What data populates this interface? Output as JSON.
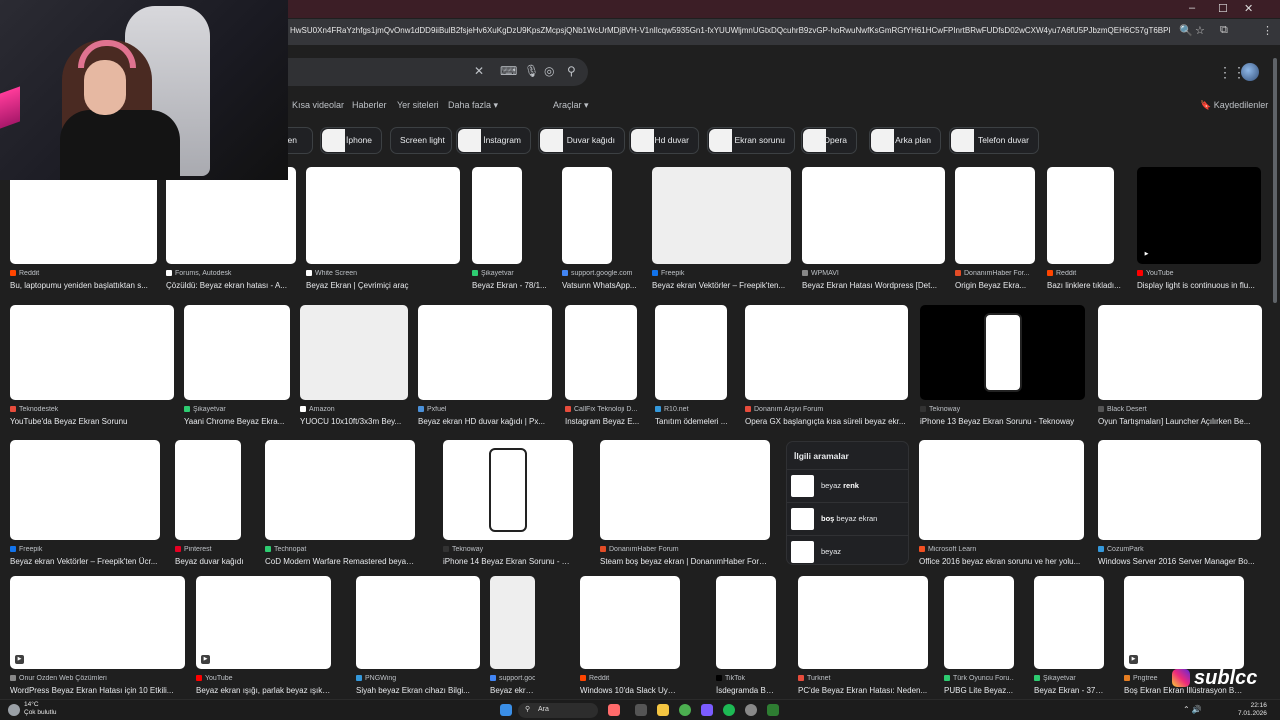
{
  "browser": {
    "url": "HwSU0Xn4FRaYzhfgs1jmQvOnw1dDD9iiBulB2fsjeHv6XuKgDzU9KpsZMcpsjQNb1WcUrMDj8VH-V1nIlcqw5935Gn1-fxYUUWljmnUGtxDQcuhrB9zvGP-hoRwuNwfKsGmRGfYH61HCwFPInrtBRwFUDfsD02wCXW4yu7A6fU5PJbzmQEH6C57gT6BPkdyn-GMIWObrYH0d93TWbG3mRemJys13yP...",
    "window_controls": [
      "–",
      "☐",
      "✕"
    ]
  },
  "search": {
    "query": "",
    "clear_icon": "close-icon",
    "keyboard_icon": "keyboard-icon",
    "mic_icon": "mic-icon",
    "lens_icon": "lens-icon",
    "search_icon": "search-icon"
  },
  "nav": {
    "tabs": [
      "Kısa videolar",
      "Haberler",
      "Yer siteleri",
      "Daha fazla ▾"
    ],
    "tools": "Araçlar ▾",
    "saved": "Kaydedilenler"
  },
  "chips": [
    {
      "label": "reen",
      "thumb": false
    },
    {
      "label": "İphone",
      "thumb": true
    },
    {
      "label": "Screen light",
      "thumb": false
    },
    {
      "label": "İnstagram",
      "thumb": true
    },
    {
      "label": "Duvar kağıdı",
      "thumb": true
    },
    {
      "label": "Hd duvar",
      "thumb": true
    },
    {
      "label": "Ekran sorunu",
      "thumb": true
    },
    {
      "label": "Opera",
      "thumb": true
    },
    {
      "label": "Arka plan",
      "thumb": true
    },
    {
      "label": "Telefon duvar",
      "thumb": true
    }
  ],
  "results": [
    {
      "source": "Reddit",
      "title": "Bu, laptopumu yeniden başlattıktan s...",
      "favicon": "#ff4500"
    },
    {
      "source": "Forums, Autodesk",
      "title": "Çözüldü: Beyaz ekran hatası - A...",
      "favicon": "#ffffff"
    },
    {
      "source": "White Screen",
      "title": "Beyaz Ekran | Çevrimiçi araç",
      "favicon": "#ffffff"
    },
    {
      "source": "Şikayetvar",
      "title": "Beyaz Ekran - 78/1...",
      "favicon": "#2ecc71"
    },
    {
      "source": "support.google.com",
      "title": "Vatsunn WhatsApp...",
      "favicon": "#4285f4"
    },
    {
      "source": "Freepik",
      "title": "Beyaz ekran Vektörler – Freepik'ten...",
      "favicon": "#1273eb"
    },
    {
      "source": "WPMAVI",
      "title": "Beyaz Ekran Hatası Wordpress [Det...",
      "favicon": "#888888"
    },
    {
      "source": "DonanımHaber For...",
      "title": "Origin Beyaz Ekra...",
      "favicon": "#e34c26"
    },
    {
      "source": "Reddit",
      "title": "Bazı linklere tıkladı...",
      "favicon": "#ff4500"
    },
    {
      "source": "YouTube",
      "title": "Display light is continuous in flu...",
      "favicon": "#ff0000"
    },
    {
      "source": "Teknodestek",
      "title": "YouTube'da Beyaz Ekran Sorunu",
      "favicon": "#e74c3c"
    },
    {
      "source": "Şikayetvar",
      "title": "Yaani Chrome Beyaz Ekra...",
      "favicon": "#2ecc71"
    },
    {
      "source": "Amazon",
      "title": "YUOCU 10x10ft/3x3m Bey...",
      "favicon": "#ffffff"
    },
    {
      "source": "Pxfuel",
      "title": "Beyaz ekran HD duvar kağıdı | Px...",
      "favicon": "#4a90d9"
    },
    {
      "source": "CallFix Teknoloji D...",
      "title": "Instagram Beyaz E...",
      "favicon": "#e74c3c"
    },
    {
      "source": "R10.net",
      "title": "Tanıtım ödemeleri ...",
      "favicon": "#3498db"
    },
    {
      "source": "Donanım Arşivi Forum",
      "title": "Opera GX başlangıçta kısa süreli beyaz ekr...",
      "favicon": "#e74c3c"
    },
    {
      "source": "Teknoway",
      "title": "iPhone 13 Beyaz Ekran Sorunu - Teknoway",
      "favicon": "#333333"
    },
    {
      "source": "Black Desert",
      "title": "Oyun Tartışmaları] Launcher Açılırken Be...",
      "favicon": "#555555"
    },
    {
      "source": "Freepik",
      "title": "Beyaz ekran Vektörler – Freepik'ten Ücr...",
      "favicon": "#1273eb"
    },
    {
      "source": "Pinterest",
      "title": "Beyaz duvar kağıdı",
      "favicon": "#e60023"
    },
    {
      "source": "Technopat",
      "title": "CoD Modern Warfare Remastered beyaz ek...",
      "favicon": "#2ecc71"
    },
    {
      "source": "Teknoway",
      "title": "iPhone 14 Beyaz Ekran Sorunu - Tek...",
      "favicon": "#333333"
    },
    {
      "source": "DonanımHaber Forum",
      "title": "Steam boş beyaz ekran | DonanımHaber Forum",
      "favicon": "#e34c26"
    },
    {
      "source": "Microsoft Learn",
      "title": "Office 2016 beyaz ekran sorunu ve her yolu...",
      "favicon": "#f25022"
    },
    {
      "source": "CozumPark",
      "title": "Windows Server 2016 Server Manager Bo...",
      "favicon": "#3498db"
    },
    {
      "source": "Onur Özden Web Çözümleri",
      "title": "WordPress Beyaz Ekran Hatası için 10 Etkili...",
      "favicon": "#888888"
    },
    {
      "source": "YouTube",
      "title": "Beyaz ekran ışığı, parlak beyaz ışık—I...",
      "favicon": "#ff0000"
    },
    {
      "source": "PNGWing",
      "title": "Siyah beyaz Ekran cihazı Bilgi...",
      "favicon": "#3498db"
    },
    {
      "source": "support.google.com",
      "title": "Beyaz ekran, beya...",
      "favicon": "#4285f4"
    },
    {
      "source": "Reddit",
      "title": "Windows 10'da Slack Uygula...",
      "favicon": "#ff4500"
    },
    {
      "source": "TikTok",
      "title": "İsdegramda Beyaz...",
      "favicon": "#000000"
    },
    {
      "source": "Turknet",
      "title": "PC'de Beyaz Ekran Hatası: Neden...",
      "favicon": "#e74c3c"
    },
    {
      "source": "Türk Oyuncu Foru...",
      "title": "PUBG Lite Beyaz...",
      "favicon": "#2ecc71"
    },
    {
      "source": "Şikayetvar",
      "title": "Beyaz Ekran - 37/1...",
      "favicon": "#2ecc71"
    },
    {
      "source": "Pngtree",
      "title": "Boş Ekran Ekran İllüstrasyon Beya...",
      "favicon": "#e67e22"
    }
  ],
  "related": {
    "title": "İlgili aramalar",
    "items": [
      {
        "prefix": "beyaz ",
        "bold": "renk",
        "suffix": ""
      },
      {
        "prefix": "",
        "bold": "boş",
        "suffix": " beyaz ekran"
      },
      {
        "prefix": "beyaz",
        "bold": "",
        "suffix": ""
      }
    ]
  },
  "taskbar": {
    "weather_temp": "14°C",
    "weather_desc": "Çok bulutlu",
    "search_label": "Ara",
    "time": "22:16",
    "date": "7.01.2026"
  },
  "overlay": {
    "brand": "sublcc"
  }
}
